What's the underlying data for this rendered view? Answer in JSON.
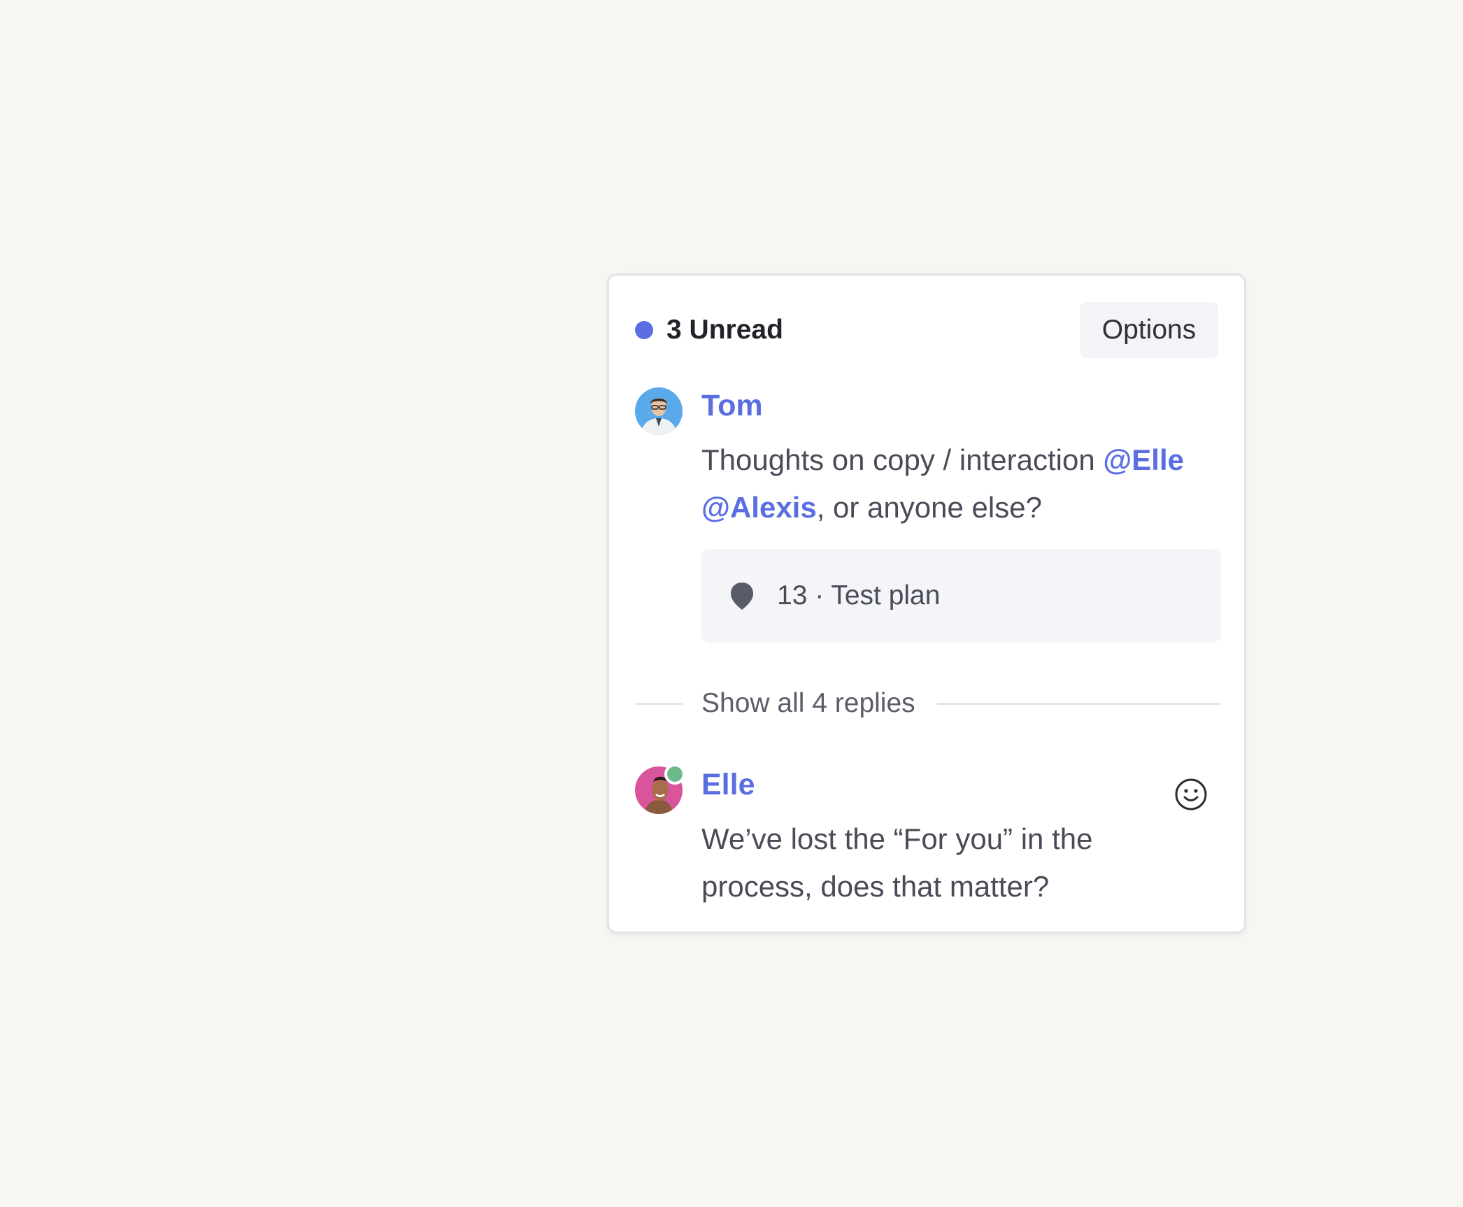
{
  "thread": {
    "unread_label": "3 Unread",
    "options_label": "Options",
    "accent_color": "#5b6ee1",
    "online_color": "#6dbb8c",
    "messages": [
      {
        "author": "Tom",
        "text_parts": [
          "Thoughts on copy / interaction ",
          "@Elle",
          " ",
          "@Alexis",
          ", or anyone else?"
        ],
        "reference": {
          "icon": "pin-icon",
          "label": "13 · Test plan"
        }
      },
      {
        "author": "Elle",
        "status": "online",
        "text": "We’ve lost the “For you” in the process, does that matter?",
        "reaction_icon": "smiley-icon"
      }
    ],
    "show_replies_label": "Show all 4 replies"
  }
}
